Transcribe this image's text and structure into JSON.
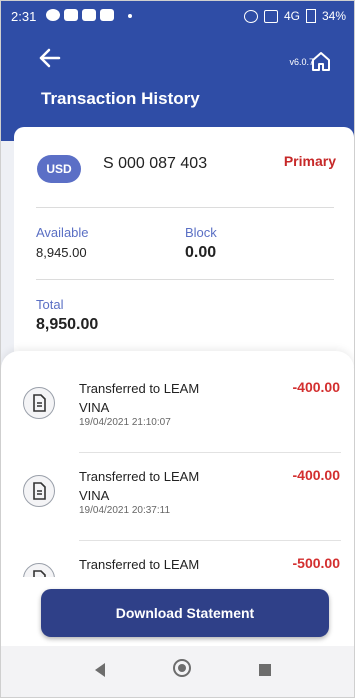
{
  "status_bar": {
    "time": "2:31",
    "network": "4G",
    "battery": "34%"
  },
  "header": {
    "version": "v6.0.7",
    "title": "Transaction History"
  },
  "account": {
    "currency": "USD",
    "number": "S 000 087 403",
    "type": "Primary",
    "available_label": "Available",
    "available_value": "8,945.00",
    "block_label": "Block",
    "block_value": "0.00",
    "total_label": "Total",
    "total_value": "8,950.00"
  },
  "transactions": [
    {
      "desc_line1": "Transferred to LEAM",
      "desc_line2": "VINA",
      "date": "19/04/2021 21:10:07",
      "amount": "-400.00"
    },
    {
      "desc_line1": "Transferred to LEAM",
      "desc_line2": "VINA",
      "date": "19/04/2021 20:37:11",
      "amount": "-400.00"
    },
    {
      "desc_line1": "Transferred to LEAM",
      "desc_line2": "",
      "date": "",
      "amount": "-500.00"
    }
  ],
  "download_button": "Download Statement",
  "colors": {
    "brand": "#2f4da6",
    "negative": "#d32f2f",
    "accent": "#5b6fc6"
  }
}
